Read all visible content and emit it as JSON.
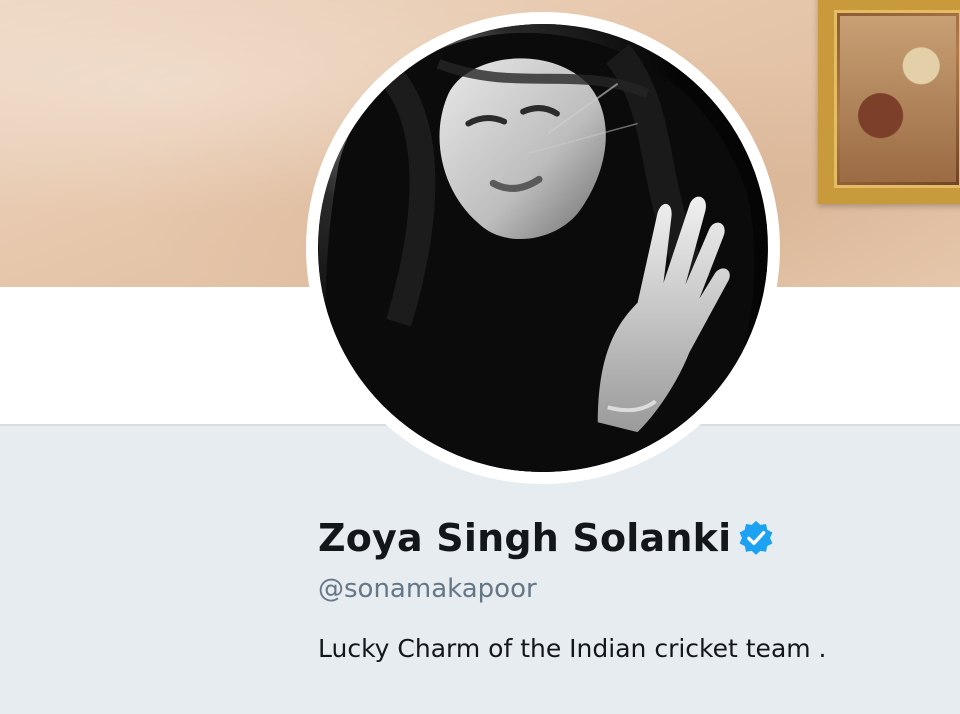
{
  "profile": {
    "display_name": "Zoya Singh Solanki",
    "handle": "@sonamakapoor",
    "bio": "Lucky Charm of the Indian cricket team .",
    "verified": true,
    "verified_icon": "verified-badge-icon"
  },
  "colors": {
    "verified_blue": "#1da1f2",
    "handle_gray": "#657786",
    "text_dark": "#14171a",
    "page_bg": "#e6ecf0"
  }
}
